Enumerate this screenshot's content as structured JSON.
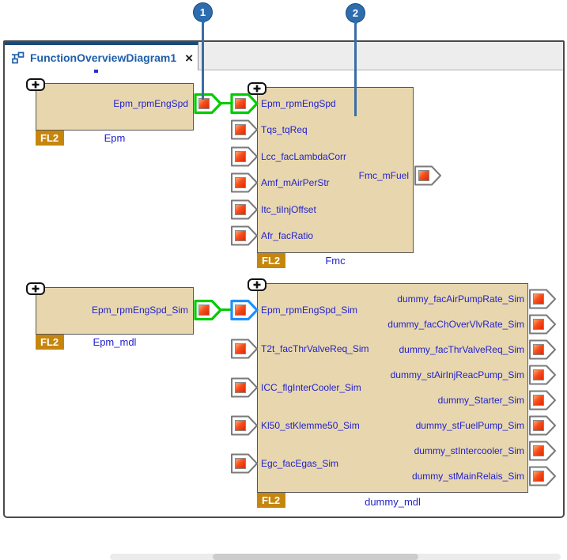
{
  "tab": {
    "title": "FunctionOverviewDiagram1",
    "close": "×"
  },
  "callouts": [
    {
      "label": "1"
    },
    {
      "label": "2"
    }
  ],
  "colors": {
    "selection_green": "#00cc00",
    "selection_blue": "#1e8fff",
    "port_outline_gray": "#7a7a7a",
    "port_square_red": "#e02500",
    "block_fill_tan": "#e8d7ae",
    "badge_orange": "#c6860e",
    "label_blue": "#2222cc",
    "tab_title_blue": "#1e5faa",
    "callout_blue": "#2d6dae"
  },
  "blocks": [
    {
      "name": "Epm",
      "badge": "FL2",
      "outputs": [
        {
          "label": "Epm_rpmEngSpd",
          "highlight": "green"
        }
      ]
    },
    {
      "name": "Fmc",
      "badge": "FL2",
      "inputs": [
        {
          "label": "Epm_rpmEngSpd",
          "highlight": "green"
        },
        {
          "label": "Tqs_tqReq"
        },
        {
          "label": "Lcc_facLambdaCorr"
        },
        {
          "label": "Amf_mAirPerStr"
        },
        {
          "label": "Itc_tiInjOffset"
        },
        {
          "label": "Afr_facRatio"
        }
      ],
      "outputs": [
        {
          "label": "Fmc_mFuel"
        }
      ]
    },
    {
      "name": "Epm_mdl",
      "badge": "FL2",
      "outputs": [
        {
          "label": "Epm_rpmEngSpd_Sim",
          "highlight": "green"
        }
      ]
    },
    {
      "name": "dummy_mdl",
      "badge": "FL2",
      "inputs": [
        {
          "label": "Epm_rpmEngSpd_Sim",
          "highlight": "blue"
        },
        {
          "label": "T2t_facThrValveReq_Sim"
        },
        {
          "label": "ICC_flgInterCooler_Sim"
        },
        {
          "label": "Kl50_stKlemme50_Sim"
        },
        {
          "label": "Egc_facEgas_Sim"
        }
      ],
      "outputs": [
        {
          "label": "dummy_facAirPumpRate_Sim"
        },
        {
          "label": "dummy_facChOverVlvRate_Sim"
        },
        {
          "label": "dummy_facThrValveReq_Sim"
        },
        {
          "label": "dummy_stAirInjReacPump_Sim"
        },
        {
          "label": "dummy_Starter_Sim"
        },
        {
          "label": "dummy_stFuelPump_Sim"
        },
        {
          "label": "dummy_stIntercooler_Sim"
        },
        {
          "label": "dummy_stMainRelais_Sim"
        }
      ]
    }
  ]
}
